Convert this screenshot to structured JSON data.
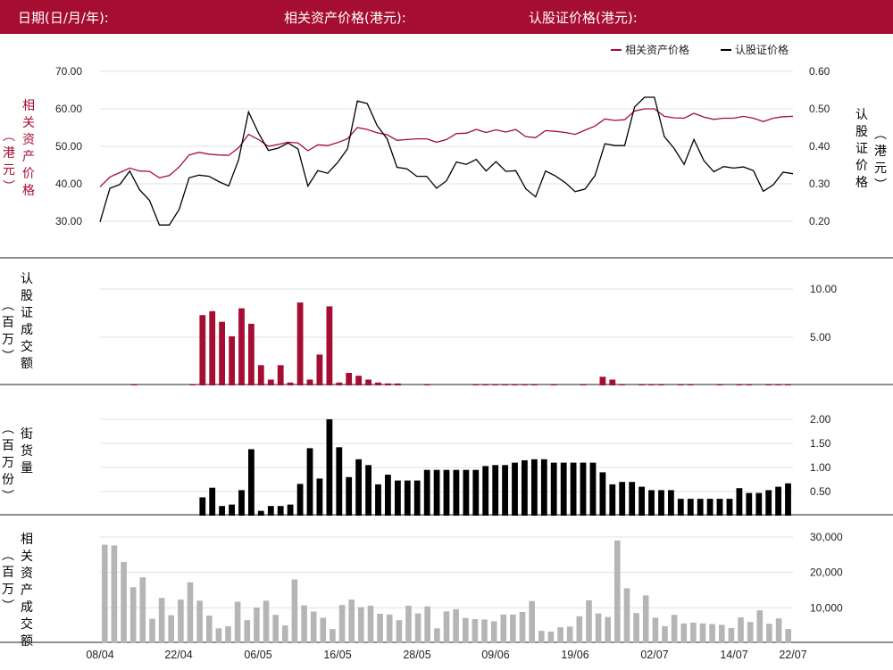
{
  "header": {
    "date_label": "日期(日/月/年):",
    "underlying_label": "相关资产价格(港元):",
    "warrant_label": "认股证价格(港元):"
  },
  "legend": {
    "underlying": "相关资产价格",
    "warrant": "认股证价格"
  },
  "axis_labels": {
    "price_left": "相关资产价格",
    "price_left_unit": "(港元)",
    "price_right": "认股证价格",
    "price_right_unit": "(港元)",
    "warrant_turnover": "认股证成交额",
    "warrant_turnover_unit": "(百万)",
    "outstanding": "街货量",
    "outstanding_unit": "(百万份)",
    "underlying_turnover": "相关资产成交额",
    "underlying_turnover_unit": "(百万)"
  },
  "colors": {
    "brand": "#a50e32",
    "warrant": "#000000",
    "underlying_bar": "#b5b5b5"
  },
  "chart_data": [
    {
      "type": "line",
      "x_ticks": [
        "08/04",
        "22/04",
        "06/05",
        "16/05",
        "28/05",
        "09/06",
        "19/06",
        "02/07",
        "14/07",
        "22/07"
      ],
      "y_left_ticks": [
        "70.00",
        "60.00",
        "50.00",
        "40.00",
        "30.00"
      ],
      "y_right_ticks": [
        "0.60",
        "0.50",
        "0.40",
        "0.30",
        "0.20"
      ],
      "ylim_left": [
        30,
        70
      ],
      "ylim_right": [
        0.2,
        0.6
      ],
      "series": [
        {
          "name": "相关资产价格",
          "axis": "left",
          "values": [
            39.2,
            41.8,
            43.0,
            44.2,
            43.4,
            43.3,
            41.6,
            42.2,
            44.5,
            47.7,
            48.4,
            47.9,
            47.7,
            47.6,
            49.6,
            53.2,
            51.8,
            50.0,
            50.5,
            51.1,
            50.9,
            48.8,
            50.4,
            50.2,
            51.0,
            52.0,
            55.0,
            54.5,
            53.6,
            53.1,
            51.6,
            51.8,
            52.0,
            52.0,
            51.1,
            51.8,
            53.4,
            53.5,
            54.5,
            53.7,
            54.4,
            53.8,
            54.5,
            52.6,
            52.3,
            54.2,
            54.0,
            53.7,
            53.2,
            54.3,
            55.4,
            57.3,
            56.9,
            57.1,
            59.4,
            60.0,
            60.0,
            58.0,
            57.6,
            57.5,
            58.8,
            57.8,
            57.2,
            57.5,
            57.5,
            58.0,
            57.5,
            56.6,
            57.5,
            57.9,
            58.0
          ]
        },
        {
          "name": "认股证价格",
          "axis": "right",
          "values": [
            0.198,
            0.288,
            0.298,
            0.334,
            0.284,
            0.256,
            0.19,
            0.19,
            0.232,
            0.316,
            0.323,
            0.32,
            0.306,
            0.294,
            0.364,
            0.492,
            0.436,
            0.389,
            0.395,
            0.409,
            0.393,
            0.294,
            0.335,
            0.328,
            0.357,
            0.393,
            0.521,
            0.514,
            0.455,
            0.42,
            0.344,
            0.34,
            0.32,
            0.32,
            0.288,
            0.308,
            0.358,
            0.352,
            0.365,
            0.334,
            0.359,
            0.333,
            0.335,
            0.287,
            0.265,
            0.334,
            0.321,
            0.303,
            0.279,
            0.286,
            0.322,
            0.407,
            0.402,
            0.402,
            0.505,
            0.531,
            0.531,
            0.426,
            0.394,
            0.352,
            0.418,
            0.362,
            0.332,
            0.346,
            0.342,
            0.345,
            0.335,
            0.28,
            0.297,
            0.331,
            0.327
          ]
        }
      ]
    },
    {
      "type": "bar",
      "series_name": "认股证成交额",
      "y_ticks": [
        "10.00",
        "5.00"
      ],
      "ylim": [
        0,
        10.0
      ],
      "values": [
        0,
        0,
        0,
        0.1,
        0,
        0,
        0,
        0,
        0,
        0.1,
        7.3,
        7.7,
        6.6,
        5.1,
        8.0,
        6.4,
        2.1,
        0.6,
        2.1,
        0.3,
        8.6,
        0.6,
        3.2,
        8.2,
        0.3,
        1.3,
        1.0,
        0.6,
        0.3,
        0.2,
        0.2,
        0,
        0,
        0.1,
        0,
        0,
        0,
        0,
        0.1,
        0.1,
        0.1,
        0.1,
        0.1,
        0.1,
        0.1,
        0,
        0.1,
        0,
        0,
        0.1,
        0,
        0.9,
        0.6,
        0.1,
        0,
        0.1,
        0.1,
        0.1,
        0,
        0.1,
        0.1,
        0,
        0,
        0.1,
        0,
        0.1,
        0.1,
        0,
        0.1,
        0.1,
        0.1
      ]
    },
    {
      "type": "bar",
      "series_name": "街货量",
      "y_ticks": [
        "2.00",
        "1.50",
        "1.00",
        "0.50"
      ],
      "ylim": [
        0,
        2.0
      ],
      "values": [
        0,
        0,
        0,
        0,
        0,
        0,
        0,
        0,
        0,
        0,
        0.38,
        0.58,
        0.2,
        0.23,
        0.53,
        1.38,
        0.1,
        0.2,
        0.2,
        0.23,
        0.66,
        1.4,
        0.77,
        2.0,
        1.42,
        0.8,
        1.17,
        1.05,
        0.65,
        0.85,
        0.73,
        0.73,
        0.73,
        0.95,
        0.95,
        0.95,
        0.95,
        0.95,
        0.95,
        1.03,
        1.05,
        1.05,
        1.1,
        1.15,
        1.17,
        1.17,
        1.1,
        1.1,
        1.1,
        1.1,
        1.1,
        0.9,
        0.65,
        0.7,
        0.7,
        0.6,
        0.53,
        0.53,
        0.53,
        0.35,
        0.35,
        0.35,
        0.35,
        0.35,
        0.35,
        0.57,
        0.47,
        0.47,
        0.53,
        0.6,
        0.67
      ]
    },
    {
      "type": "bar",
      "series_name": "相关资产成交额",
      "y_ticks": [
        "30,000",
        "20,000",
        "10,000"
      ],
      "ylim": [
        0,
        36000
      ],
      "values": [
        27800,
        27600,
        22900,
        15800,
        18600,
        6900,
        12800,
        7900,
        12300,
        17200,
        12000,
        7800,
        4200,
        4800,
        11700,
        6500,
        10100,
        12000,
        8000,
        5000,
        18000,
        10700,
        8900,
        7200,
        4000,
        10800,
        12300,
        10200,
        10600,
        8300,
        8100,
        6500,
        10600,
        8400,
        10400,
        4200,
        9000,
        9600,
        7100,
        6800,
        6700,
        6200,
        8100,
        8100,
        8800,
        11900,
        3500,
        3300,
        4500,
        4700,
        7600,
        12100,
        8400,
        7400,
        29000,
        15500,
        8500,
        13500,
        7200,
        4800,
        8000,
        5600,
        5800,
        5600,
        5400,
        5200,
        4300,
        7300,
        6000,
        9300,
        5500,
        7000,
        4000
      ]
    }
  ]
}
